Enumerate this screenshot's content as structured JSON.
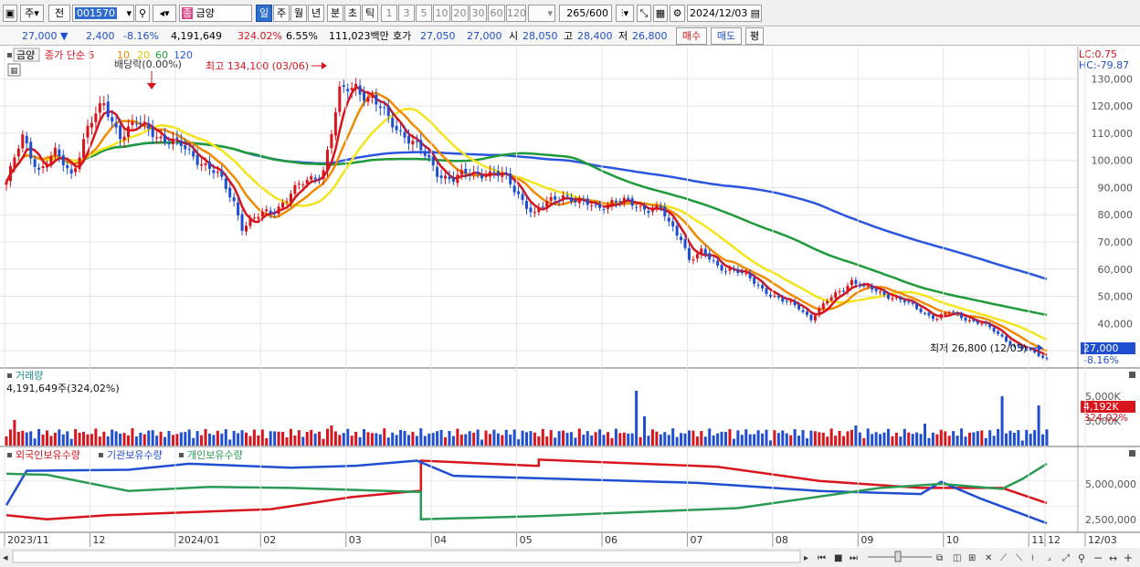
{
  "toolbar": {
    "period_day": "주",
    "chart_kind": "전",
    "code": "001570",
    "stock_name": "금양",
    "stock_badge": "종",
    "periods": [
      "일",
      "주",
      "월",
      "년",
      "분",
      "초",
      "틱"
    ],
    "intervals": [
      "1",
      "3",
      "5",
      "10",
      "20",
      "30",
      "60",
      "120"
    ],
    "count": "265",
    "count_total": "/600",
    "date": "2024/12/03"
  },
  "quote": {
    "price": "27,000",
    "change": "2,400",
    "change_pct": "-8.16%",
    "volume": "4,191,649",
    "volume_ratio": "324.02%",
    "turnover": "6.55%",
    "amount": "111,023백만",
    "bid_label": "호가",
    "bid1": "27,050",
    "bid2": "27,000",
    "open_label": "시",
    "open": "28,050",
    "high_label": "고",
    "high": "28,400",
    "low_label": "저",
    "low": "26,800",
    "buy": "매수",
    "sell": "매도",
    "avg": "평"
  },
  "colors": {
    "up": "#d8141c",
    "down": "#1f4fd0",
    "ma5": "#d8141c",
    "ma10": "#f08a00",
    "ma20": "#f4e41c",
    "ma60": "#1f9a3a",
    "ma120": "#2a55e0"
  },
  "chart_data": [
    {
      "type": "candlestick",
      "title": "금양",
      "legend": [
        "종가 단순 5",
        "10",
        "20",
        "60",
        "120"
      ],
      "dividend_label": "배당락(0.00%)",
      "annotations": {
        "high": "최고 134,100 (03/06)",
        "low": "최저 26,800 (12/03)",
        "lc": "LC:0.75",
        "hc": "HC:-79.87"
      },
      "last_price_label": "27,000",
      "last_change_label": "-8.16%",
      "y_ticks": [
        30000,
        40000,
        50000,
        60000,
        70000,
        80000,
        90000,
        100000,
        110000,
        120000,
        130000
      ],
      "y_tick_labels": [
        "30,000",
        "40,000",
        "50,000",
        "60,000",
        "70,000",
        "80,000",
        "90,000",
        "100,000",
        "110,000",
        "120,000",
        "130,000"
      ],
      "ylim": [
        26000,
        134500
      ],
      "x_labels": [
        "2023/11",
        "12",
        "2024/01",
        "02",
        "03",
        "04",
        "05",
        "06",
        "07",
        "08",
        "09",
        "10",
        "11",
        "12",
        "12/03"
      ],
      "close_path": [
        [
          0,
          92000
        ],
        [
          4,
          108000
        ],
        [
          8,
          97000
        ],
        [
          12,
          102000
        ],
        [
          16,
          95000
        ],
        [
          20,
          112000
        ],
        [
          24,
          120000
        ],
        [
          28,
          110000
        ],
        [
          32,
          113000
        ],
        [
          36,
          111000
        ],
        [
          40,
          107000
        ],
        [
          44,
          104000
        ],
        [
          48,
          100000
        ],
        [
          52,
          94000
        ],
        [
          56,
          85000
        ],
        [
          58,
          76000
        ],
        [
          62,
          79000
        ],
        [
          66,
          82000
        ],
        [
          70,
          88000
        ],
        [
          74,
          92000
        ],
        [
          78,
          97000
        ],
        [
          82,
          124000
        ],
        [
          86,
          128000
        ],
        [
          90,
          122000
        ],
        [
          94,
          115000
        ],
        [
          98,
          110000
        ],
        [
          102,
          103000
        ],
        [
          106,
          96000
        ],
        [
          110,
          93000
        ],
        [
          114,
          95000
        ],
        [
          118,
          96000
        ],
        [
          122,
          94000
        ],
        [
          126,
          88000
        ],
        [
          130,
          80000
        ],
        [
          133,
          84000
        ],
        [
          137,
          88000
        ],
        [
          141,
          84000
        ],
        [
          145,
          83000
        ],
        [
          149,
          85000
        ],
        [
          153,
          84000
        ],
        [
          157,
          83000
        ],
        [
          161,
          82000
        ],
        [
          163,
          76000
        ],
        [
          166,
          72000
        ],
        [
          168,
          64000
        ],
        [
          171,
          66000
        ],
        [
          175,
          61000
        ],
        [
          179,
          60000
        ],
        [
          183,
          56000
        ],
        [
          187,
          52000
        ],
        [
          191,
          48000
        ],
        [
          195,
          46000
        ],
        [
          198,
          42000
        ],
        [
          202,
          48000
        ],
        [
          205,
          52000
        ],
        [
          208,
          56000
        ],
        [
          211,
          53000
        ],
        [
          214,
          52000
        ],
        [
          218,
          50000
        ],
        [
          222,
          47000
        ],
        [
          226,
          44000
        ],
        [
          229,
          42000
        ],
        [
          232,
          44000
        ],
        [
          236,
          42000
        ],
        [
          240,
          40000
        ],
        [
          244,
          36000
        ],
        [
          248,
          32000
        ],
        [
          252,
          29500
        ],
        [
          256,
          27000
        ]
      ]
    },
    {
      "type": "bar",
      "title": "거래량",
      "subtitle": "4,191,649주(324,02%)",
      "y_tick_labels": [
        "5,000K",
        "3,000K"
      ],
      "last_label": "4,192K",
      "last_ratio": "324.02%"
    },
    {
      "type": "line",
      "series": [
        {
          "name": "외국인보유수량",
          "color": "#d8141c",
          "values": [
            [
              0,
              1600000
            ],
            [
              10,
              1200000
            ],
            [
              25,
              1600000
            ],
            [
              45,
              1900000
            ],
            [
              65,
              2200000
            ],
            [
              85,
              3400000
            ],
            [
              101,
              4000000
            ],
            [
              102,
              7000000
            ],
            [
              130,
              6500000
            ],
            [
              131,
              7100000
            ],
            [
              175,
              6400000
            ],
            [
              200,
              5000000
            ],
            [
              225,
              4300000
            ],
            [
              245,
              4300000
            ],
            [
              256,
              2800000
            ]
          ]
        },
        {
          "name": "기관보유수량",
          "color": "#1f4fd0",
          "values": [
            [
              0,
              2600000
            ],
            [
              5,
              6000000
            ],
            [
              30,
              6100000
            ],
            [
              45,
              6700000
            ],
            [
              70,
              6300000
            ],
            [
              86,
              6500000
            ],
            [
              101,
              7000000
            ],
            [
              110,
              5500000
            ],
            [
              170,
              4800000
            ],
            [
              200,
              4000000
            ],
            [
              225,
              3700000
            ],
            [
              230,
              4900000
            ],
            [
              240,
              3200000
            ],
            [
              256,
              800000
            ]
          ]
        },
        {
          "name": "개인보유수량",
          "color": "#2a9a55",
          "values": [
            [
              0,
              5700000
            ],
            [
              10,
              5600000
            ],
            [
              30,
              4000000
            ],
            [
              50,
              4400000
            ],
            [
              70,
              4300000
            ],
            [
              101,
              3900000
            ],
            [
              102,
              1200000
            ],
            [
              130,
              1500000
            ],
            [
              180,
              2300000
            ],
            [
              215,
              4300000
            ],
            [
              230,
              4700000
            ],
            [
              245,
              4200000
            ],
            [
              250,
              5200000
            ],
            [
              256,
              6700000
            ]
          ]
        }
      ],
      "y_tick_labels": [
        "5,000,000",
        "2,500,000"
      ]
    }
  ]
}
